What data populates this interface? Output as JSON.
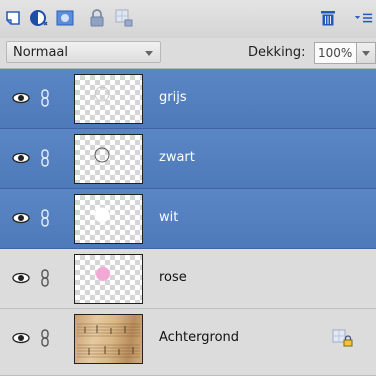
{
  "toolbar": {
    "icons": [
      "new-layer-icon",
      "adjustment-layer-icon",
      "layer-mask-icon",
      "lock-all-icon",
      "lock-transparency-icon",
      "trash-icon",
      "panel-menu-icon"
    ]
  },
  "blend": {
    "mode": "Normaal",
    "opacity_label": "Dekking:",
    "opacity_value": "100%"
  },
  "layers": [
    {
      "name": "grijs",
      "selected": true,
      "thumb": "gray-circle"
    },
    {
      "name": "zwart",
      "selected": true,
      "thumb": "black-circle"
    },
    {
      "name": "wit",
      "selected": true,
      "thumb": "white-circle"
    },
    {
      "name": "rose",
      "selected": false,
      "thumb": "pink-circle"
    },
    {
      "name": "Achtergrond",
      "selected": false,
      "thumb": "sheet-music",
      "locked": true
    }
  ],
  "colors": {
    "selected_row": "#5a86c6",
    "pink_dot": "#f2a9d6",
    "trash_blue": "#2458b8"
  }
}
